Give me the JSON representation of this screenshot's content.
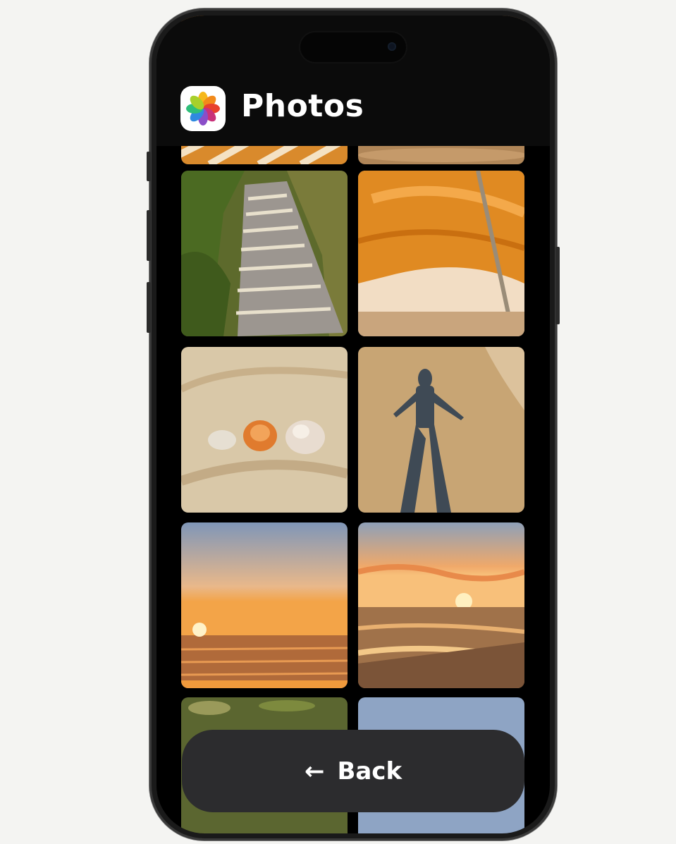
{
  "app": {
    "title": "Photos",
    "icon": "photos-app-icon"
  },
  "photos": [
    {
      "name": "photo-striped-umbrella-partial",
      "visible": "partial"
    },
    {
      "name": "photo-sand-partial",
      "visible": "partial"
    },
    {
      "name": "photo-stone-stairs-path"
    },
    {
      "name": "photo-orange-beach-umbrella"
    },
    {
      "name": "photo-seashells-in-sand"
    },
    {
      "name": "photo-shadow-on-sand"
    },
    {
      "name": "photo-sunset-over-sea"
    },
    {
      "name": "photo-sunset-beach-waves"
    },
    {
      "name": "photo-greenery-partial",
      "visible": "partial"
    },
    {
      "name": "photo-sky-partial",
      "visible": "partial"
    }
  ],
  "back_button": {
    "arrow": "←",
    "label": "Back"
  },
  "colors": {
    "screen_background": "#000000",
    "button_background": "#2c2c2e",
    "text": "#ffffff"
  }
}
